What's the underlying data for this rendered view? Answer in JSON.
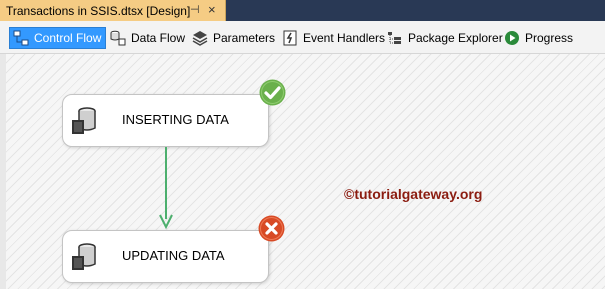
{
  "document": {
    "tab_title": "Transactions in SSIS.dtsx [Design]",
    "pin_glyph": "⊣",
    "close_glyph": "×"
  },
  "toolbar": {
    "items": [
      {
        "label": "Control Flow",
        "icon": "control-flow-icon",
        "active": true
      },
      {
        "label": "Data Flow",
        "icon": "data-flow-icon",
        "active": false
      },
      {
        "label": "Parameters",
        "icon": "parameters-icon",
        "active": false
      },
      {
        "label": "Event Handlers",
        "icon": "event-handlers-icon",
        "active": false
      },
      {
        "label": "Package Explorer",
        "icon": "package-explorer-icon",
        "active": false
      },
      {
        "label": "Progress",
        "icon": "progress-icon",
        "active": false
      }
    ]
  },
  "tasks": [
    {
      "label": "INSERTING DATA",
      "status": "success",
      "status_icon": "check-icon"
    },
    {
      "label": "UPDATING DATA",
      "status": "failure",
      "status_icon": "error-x-icon"
    }
  ],
  "watermark": "©tutorialgateway.org",
  "colors": {
    "tab_bg": "#f5cc84",
    "active_toolbar": "#3399ff",
    "success": "#6ab04c",
    "failure": "#d84a25",
    "precedence_arrow": "#4caf6d",
    "watermark": "#8b1c10"
  }
}
